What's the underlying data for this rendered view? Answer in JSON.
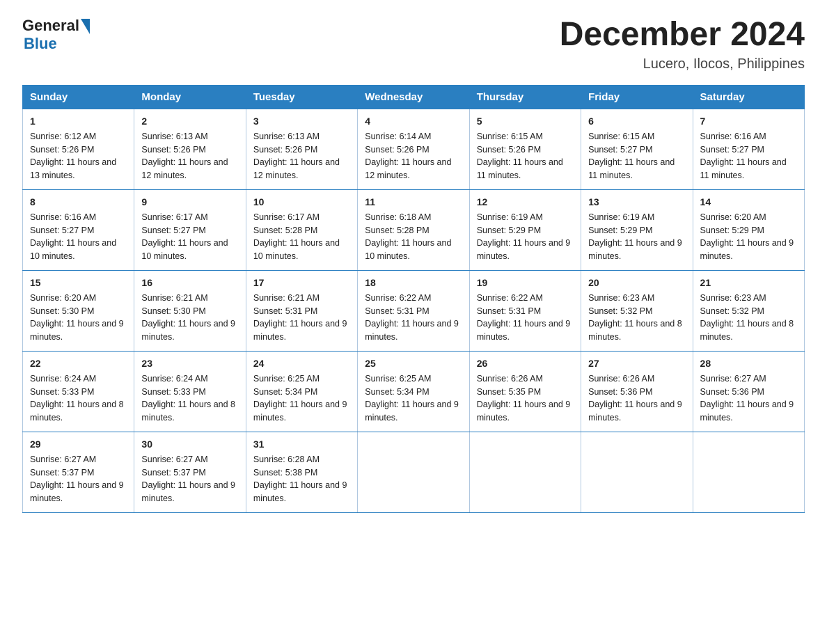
{
  "header": {
    "logo_general": "General",
    "logo_blue": "Blue",
    "month_title": "December 2024",
    "location": "Lucero, Ilocos, Philippines"
  },
  "days_of_week": [
    "Sunday",
    "Monday",
    "Tuesday",
    "Wednesday",
    "Thursday",
    "Friday",
    "Saturday"
  ],
  "weeks": [
    [
      {
        "day": "1",
        "sunrise": "6:12 AM",
        "sunset": "5:26 PM",
        "daylight": "11 hours and 13 minutes."
      },
      {
        "day": "2",
        "sunrise": "6:13 AM",
        "sunset": "5:26 PM",
        "daylight": "11 hours and 12 minutes."
      },
      {
        "day": "3",
        "sunrise": "6:13 AM",
        "sunset": "5:26 PM",
        "daylight": "11 hours and 12 minutes."
      },
      {
        "day": "4",
        "sunrise": "6:14 AM",
        "sunset": "5:26 PM",
        "daylight": "11 hours and 12 minutes."
      },
      {
        "day": "5",
        "sunrise": "6:15 AM",
        "sunset": "5:26 PM",
        "daylight": "11 hours and 11 minutes."
      },
      {
        "day": "6",
        "sunrise": "6:15 AM",
        "sunset": "5:27 PM",
        "daylight": "11 hours and 11 minutes."
      },
      {
        "day": "7",
        "sunrise": "6:16 AM",
        "sunset": "5:27 PM",
        "daylight": "11 hours and 11 minutes."
      }
    ],
    [
      {
        "day": "8",
        "sunrise": "6:16 AM",
        "sunset": "5:27 PM",
        "daylight": "11 hours and 10 minutes."
      },
      {
        "day": "9",
        "sunrise": "6:17 AM",
        "sunset": "5:27 PM",
        "daylight": "11 hours and 10 minutes."
      },
      {
        "day": "10",
        "sunrise": "6:17 AM",
        "sunset": "5:28 PM",
        "daylight": "11 hours and 10 minutes."
      },
      {
        "day": "11",
        "sunrise": "6:18 AM",
        "sunset": "5:28 PM",
        "daylight": "11 hours and 10 minutes."
      },
      {
        "day": "12",
        "sunrise": "6:19 AM",
        "sunset": "5:29 PM",
        "daylight": "11 hours and 9 minutes."
      },
      {
        "day": "13",
        "sunrise": "6:19 AM",
        "sunset": "5:29 PM",
        "daylight": "11 hours and 9 minutes."
      },
      {
        "day": "14",
        "sunrise": "6:20 AM",
        "sunset": "5:29 PM",
        "daylight": "11 hours and 9 minutes."
      }
    ],
    [
      {
        "day": "15",
        "sunrise": "6:20 AM",
        "sunset": "5:30 PM",
        "daylight": "11 hours and 9 minutes."
      },
      {
        "day": "16",
        "sunrise": "6:21 AM",
        "sunset": "5:30 PM",
        "daylight": "11 hours and 9 minutes."
      },
      {
        "day": "17",
        "sunrise": "6:21 AM",
        "sunset": "5:31 PM",
        "daylight": "11 hours and 9 minutes."
      },
      {
        "day": "18",
        "sunrise": "6:22 AM",
        "sunset": "5:31 PM",
        "daylight": "11 hours and 9 minutes."
      },
      {
        "day": "19",
        "sunrise": "6:22 AM",
        "sunset": "5:31 PM",
        "daylight": "11 hours and 9 minutes."
      },
      {
        "day": "20",
        "sunrise": "6:23 AM",
        "sunset": "5:32 PM",
        "daylight": "11 hours and 8 minutes."
      },
      {
        "day": "21",
        "sunrise": "6:23 AM",
        "sunset": "5:32 PM",
        "daylight": "11 hours and 8 minutes."
      }
    ],
    [
      {
        "day": "22",
        "sunrise": "6:24 AM",
        "sunset": "5:33 PM",
        "daylight": "11 hours and 8 minutes."
      },
      {
        "day": "23",
        "sunrise": "6:24 AM",
        "sunset": "5:33 PM",
        "daylight": "11 hours and 8 minutes."
      },
      {
        "day": "24",
        "sunrise": "6:25 AM",
        "sunset": "5:34 PM",
        "daylight": "11 hours and 9 minutes."
      },
      {
        "day": "25",
        "sunrise": "6:25 AM",
        "sunset": "5:34 PM",
        "daylight": "11 hours and 9 minutes."
      },
      {
        "day": "26",
        "sunrise": "6:26 AM",
        "sunset": "5:35 PM",
        "daylight": "11 hours and 9 minutes."
      },
      {
        "day": "27",
        "sunrise": "6:26 AM",
        "sunset": "5:36 PM",
        "daylight": "11 hours and 9 minutes."
      },
      {
        "day": "28",
        "sunrise": "6:27 AM",
        "sunset": "5:36 PM",
        "daylight": "11 hours and 9 minutes."
      }
    ],
    [
      {
        "day": "29",
        "sunrise": "6:27 AM",
        "sunset": "5:37 PM",
        "daylight": "11 hours and 9 minutes."
      },
      {
        "day": "30",
        "sunrise": "6:27 AM",
        "sunset": "5:37 PM",
        "daylight": "11 hours and 9 minutes."
      },
      {
        "day": "31",
        "sunrise": "6:28 AM",
        "sunset": "5:38 PM",
        "daylight": "11 hours and 9 minutes."
      },
      null,
      null,
      null,
      null
    ]
  ]
}
